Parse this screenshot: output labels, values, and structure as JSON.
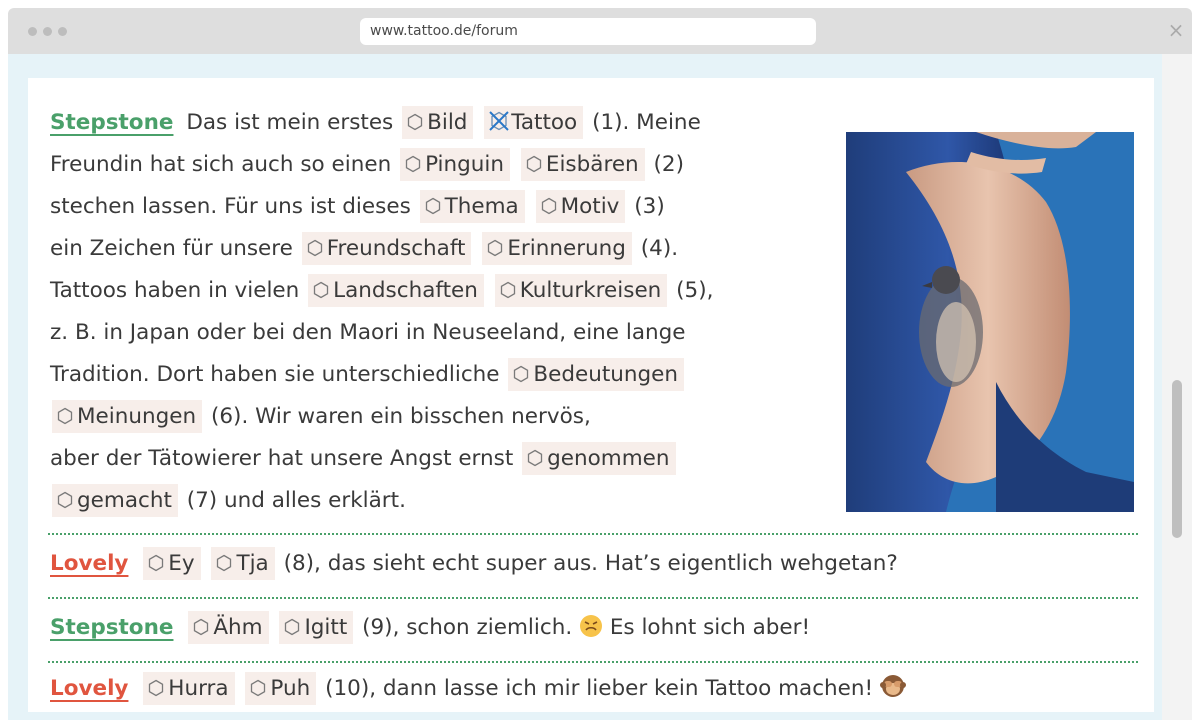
{
  "browser": {
    "url": "www.tattoo.de/forum",
    "close_icon": "close-icon"
  },
  "forum": {
    "post1": {
      "user": "Stepstone",
      "t1": "Das ist mein erstes",
      "o1a": "Bild",
      "o1b": "Tattoo",
      "n1": "(1). Meine",
      "t2": "Freundin hat sich auch so einen",
      "o2a": "Pinguin",
      "o2b": "Eisbären",
      "n2": "(2)",
      "t3": "stechen lassen. Für uns ist dieses",
      "o3a": "Thema",
      "o3b": "Motiv",
      "n3": "(3)",
      "t4": "ein Zeichen für unsere",
      "o4a": "Freundschaft",
      "o4b": "Erinnerung",
      "n4": "(4).",
      "t5": "Tattoos haben in vielen",
      "o5a": "Landschaften",
      "o5b": "Kulturkreisen",
      "n5": "(5),",
      "t6": "z. B. in Japan oder bei den Maori in Neuseeland, eine lange",
      "t7": "Tradition. Dort haben sie unterschiedliche",
      "o6a": "Bedeutungen",
      "o6b": "Meinungen",
      "n6": "(6). Wir waren ein bisschen nervös,",
      "t9": "aber der Tätowierer hat unsere Angst ernst",
      "o7a": "genommen",
      "o7b": "gemacht",
      "n7": "(7) und alles erklärt."
    },
    "post2": {
      "user": "Lovely",
      "o8a": "Ey",
      "o8b": "Tja",
      "text": "(8), das sieht echt super aus. Hat’s eigentlich wehgetan?"
    },
    "post3": {
      "user": "Stepstone",
      "o9a": "Ähm",
      "o9b": "Igitt",
      "text": "(9), schon ziemlich.",
      "text2": "Es lohnt sich aber!",
      "emoji": "grimacing-face-emoji"
    },
    "post4": {
      "user": "Lovely",
      "o10a": "Hurra",
      "o10b": "Puh",
      "text": "(10), dann lasse ich mir lieber kein Tattoo machen!",
      "emoji": "see-no-evil-monkey-emoji"
    }
  },
  "colors": {
    "green_user": "#4aa06a",
    "red_user": "#e0553f",
    "option_bg": "#f7eeea",
    "frame_bg": "#e6f3f8"
  }
}
